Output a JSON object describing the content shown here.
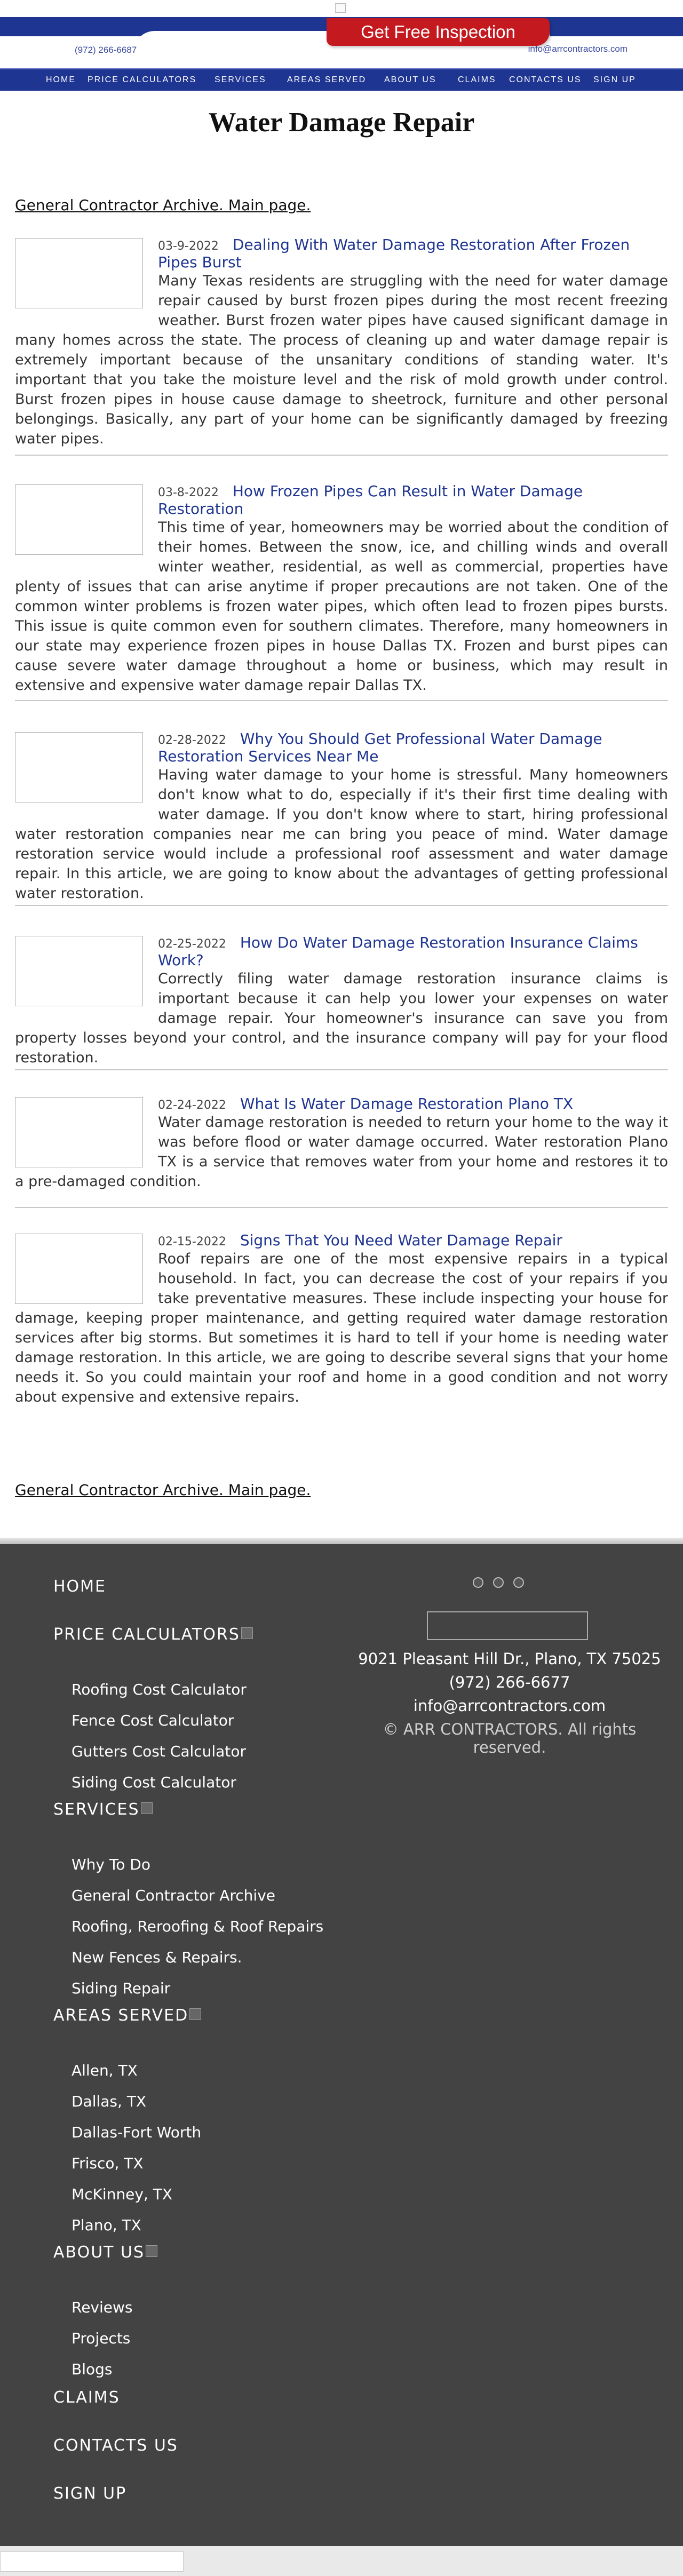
{
  "header": {
    "phone": "(972) 266-6687",
    "email": "info@arrcontractors.com",
    "cta_label": "Get Free Inspection"
  },
  "nav": {
    "items": [
      "HOME",
      "PRICE CALCULATORS",
      "SERVICES",
      "AREAS SERVED",
      "ABOUT US",
      "CLAIMS",
      "CONTACTS US",
      "SIGN UP"
    ]
  },
  "main": {
    "title": "Water Damage Repair",
    "archive_link": "General Contractor Archive. Main page.",
    "articles": [
      {
        "date": "03-9-2022",
        "title": "Dealing With Water Damage Restoration After Frozen Pipes Burst",
        "body": "Many Texas residents are struggling with the need for water damage repair caused by burst frozen pipes during the most recent freezing weather. Burst frozen water pipes have caused significant damage in many homes across the state. The process of cleaning up and water damage repair is extremely important because of the unsanitary conditions of standing water. It's important that you take the moisture level and the risk of mold growth under control. Burst frozen pipes in house cause damage to sheetrock, furniture and other personal belongings. Basically, any part of your home can be significantly damaged by freezing water pipes."
      },
      {
        "date": "03-8-2022",
        "title": "How Frozen Pipes Can Result in Water Damage Restoration",
        "body": "This time of year, homeowners may be worried about the condition of their homes. Between the snow, ice, and chilling winds and overall winter weather, residential, as well as commercial, properties have plenty of issues that can arise anytime if proper precautions are not taken. One of the common winter problems is frozen water pipes, which often lead to frozen pipes bursts. This issue is quite common even for southern climates. Therefore, many homeowners in our state may experience frozen pipes in house Dallas TX. Frozen and burst pipes can cause severe water damage throughout a home or business, which may result in extensive and expensive water damage repair Dallas TX."
      },
      {
        "date": "02-28-2022",
        "title": "Why You Should Get Professional Water Damage Restoration Services Near Me",
        "body": "Having water damage to your home is stressful. Many homeowners don't know what to do, especially if it's their first time dealing with water damage. If you don't know where to start, hiring professional water restoration companies near me can bring you peace of mind. Water damage restoration service would include a professional roof assessment and water damage repair. In this article, we are going to know about the advantages of getting professional water restoration."
      },
      {
        "date": "02-25-2022",
        "title": "How Do Water Damage Restoration Insurance Claims Work?",
        "body": "Correctly filing water damage restoration insurance claims is important because it can help you lower your expenses on water damage repair. Your homeowner's insurance can save you from property losses beyond your control, and the insurance company will pay for your flood restoration."
      },
      {
        "date": "02-24-2022",
        "title": "What Is Water Damage Restoration Plano TX",
        "body": "Water damage restoration is needed to return your home to the way it was before flood or water damage occurred. Water restoration Plano TX is a service that removes water from your home and restores it to a pre-damaged condition."
      },
      {
        "date": "02-15-2022",
        "title": "Signs That You Need Water Damage Repair",
        "body": "Roof repairs are one of the most expensive repairs in a typical household. In fact, you can decrease the cost of your repairs if you take preventative measures. These include inspecting your house for damage, keeping proper maintenance, and getting required water damage restoration services after big storms. But sometimes it is hard to tell if your home is needing water damage restoration. In this article, we are going to describe several signs that your home needs it. So you could maintain your roof and home in a good condition and not worry about expensive and extensive repairs."
      }
    ]
  },
  "footer": {
    "home": "HOME",
    "price_calculators": "PRICE CALCULATORS",
    "price_items": [
      "Roofing Cost Calculator",
      "Fence Cost Calculator",
      "Gutters Cost Calculator",
      "Siding Cost Calculator"
    ],
    "services": "SERVICES",
    "services_items": [
      "Why To Do",
      "General Contractor Archive",
      "Roofing, Reroofing & Roof Repairs",
      "New Fences & Repairs.",
      "Siding Repair"
    ],
    "areas": "AREAS SERVED",
    "areas_items": [
      "Allen, TX",
      "Dallas, TX",
      "Dallas-Fort Worth",
      "Frisco, TX",
      "McKinney, TX",
      "Plano, TX"
    ],
    "about": "ABOUT US",
    "about_items": [
      "Reviews",
      "Projects",
      "Blogs"
    ],
    "claims": "CLAIMS",
    "contacts": "CONTACTS US",
    "signup": "SIGN UP",
    "address": "9021 Pleasant Hill Dr., Plano, TX 75025",
    "phone": "(972) 266-6677",
    "email": "info@arrcontractors.com",
    "copyright": "© ARR CONTRACTORS. All rights reserved."
  }
}
